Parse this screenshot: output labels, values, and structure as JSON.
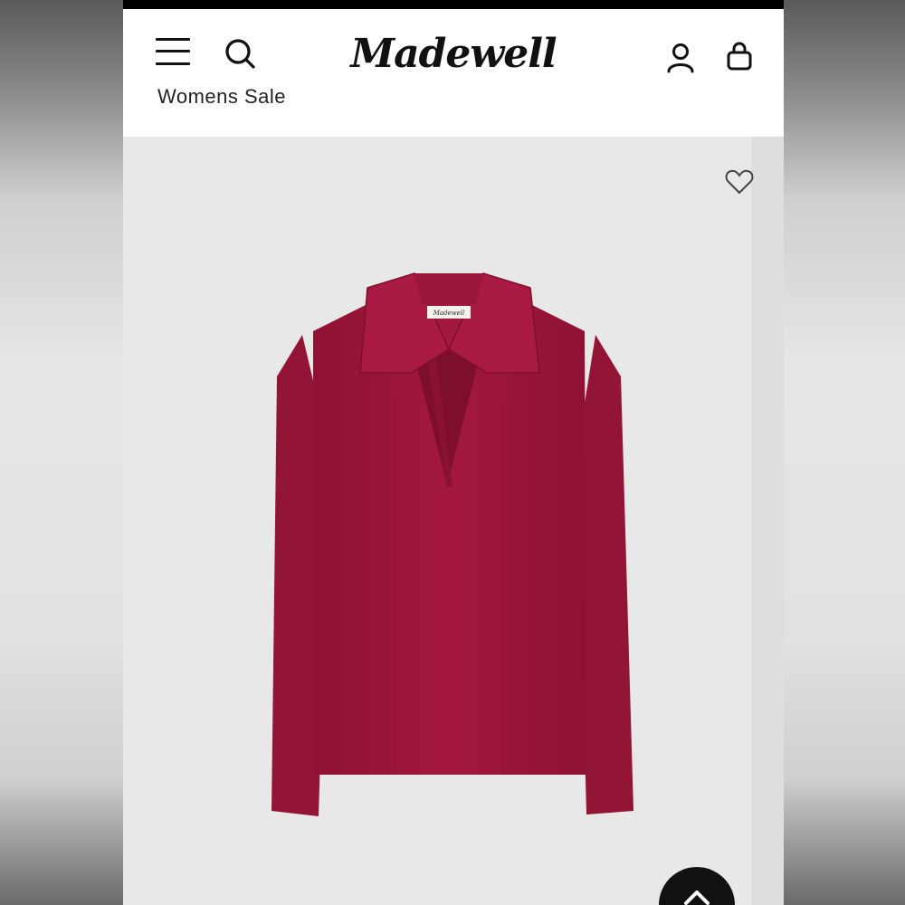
{
  "brand": {
    "logo_text": "Madewell"
  },
  "header": {
    "icons": [
      "menu-icon",
      "search-icon",
      "account-icon",
      "shopping-bag-icon"
    ]
  },
  "breadcrumb": {
    "text": "Womens Sale"
  },
  "product": {
    "image": "red-polo-sweater",
    "color": "#a3183c",
    "tag_text": "Madewell",
    "wishlist_icon": "heart-icon"
  },
  "scroll_top": {
    "icon": "chevron-up-icon"
  },
  "colors": {
    "header_bg": "#ffffff",
    "product_bg": "#e8e8e8",
    "accent": "#111111"
  }
}
